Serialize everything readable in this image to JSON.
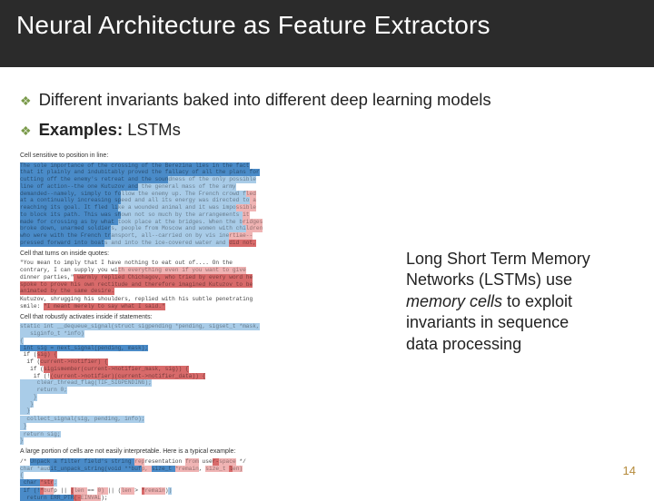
{
  "title": "Neural Architecture as Feature Extractors",
  "bullets": [
    {
      "text": "Different invariants baked into different deep learning models",
      "bold": null
    },
    {
      "bold": "Examples:",
      "text": " LSTMs"
    }
  ],
  "caption": {
    "pre": "Long Short Term Memory Networks (LSTMs) use ",
    "em": "memory cells",
    "post": " to exploit invariants in sequence data processing"
  },
  "viz": {
    "sections": [
      "Cell sensitive to position in line:",
      "Cell that turns on inside quotes:",
      "Cell that robustly activates inside if statements:",
      "A large portion of cells are not easily interpretable. Here is a typical example:"
    ]
  },
  "page_number": "14"
}
